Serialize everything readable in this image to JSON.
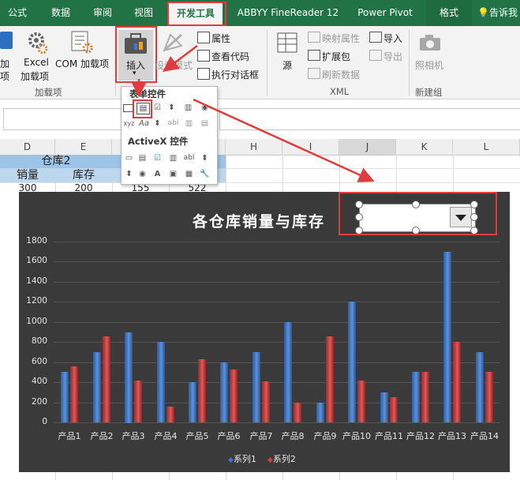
{
  "tabs": [
    "公式",
    "数据",
    "审阅",
    "视图",
    "开发工具",
    "ABBYY FineReader 12",
    "Power Pivot",
    "格式",
    "告诉我"
  ],
  "ribbon": {
    "addin_frag": "加",
    "addin_frag2": "项",
    "excel_addins": "Excel",
    "excel_addins2": "加载项",
    "com_addins": "COM 加载项",
    "insert": "插入",
    "design_mode": "设计模式",
    "properties": "属性",
    "view_code": "查看代码",
    "run_dialog": "执行对话框",
    "source": "源",
    "map_props": "映射属性",
    "expansion_pack": "扩展包",
    "refresh_data": "刷新数据",
    "import": "导入",
    "export": "导出",
    "camera": "照相机",
    "group_addins": "加载项",
    "group_xml": "XML",
    "group_new": "新建组"
  },
  "popup": {
    "form_controls": "表单控件",
    "activex_controls": "ActiveX 控件"
  },
  "columns": [
    "D",
    "E",
    "F",
    "G",
    "H",
    "I",
    "J",
    "K",
    "L"
  ],
  "cells": {
    "warehouse2": "仓库2",
    "sales": "销量",
    "stock": "库存",
    "r3": [
      "300",
      "200",
      "155",
      "522"
    ]
  },
  "chart_data": {
    "type": "bar",
    "title": "各仓库销量与库存",
    "categories": [
      "产品1",
      "产品2",
      "产品3",
      "产品4",
      "产品5",
      "产品6",
      "产品7",
      "产品8",
      "产品9",
      "产品10",
      "产品11",
      "产品12",
      "产品13",
      "产品14"
    ],
    "series": [
      {
        "name": "系列1",
        "values": [
          500,
          700,
          900,
          800,
          400,
          600,
          700,
          1000,
          200,
          1200,
          300,
          500,
          1700,
          700
        ]
      },
      {
        "name": "系列2",
        "values": [
          560,
          860,
          420,
          160,
          630,
          530,
          410,
          200,
          860,
          420,
          250,
          500,
          800,
          500
        ]
      }
    ],
    "ylim": [
      0,
      1800
    ],
    "yticks": [
      "0",
      "200",
      "400",
      "600",
      "800",
      "1000",
      "1200",
      "1400",
      "1600",
      "1800"
    ],
    "legend": "bottom",
    "colors": {
      "series1": "#3f78c8",
      "series2": "#d04343"
    }
  }
}
